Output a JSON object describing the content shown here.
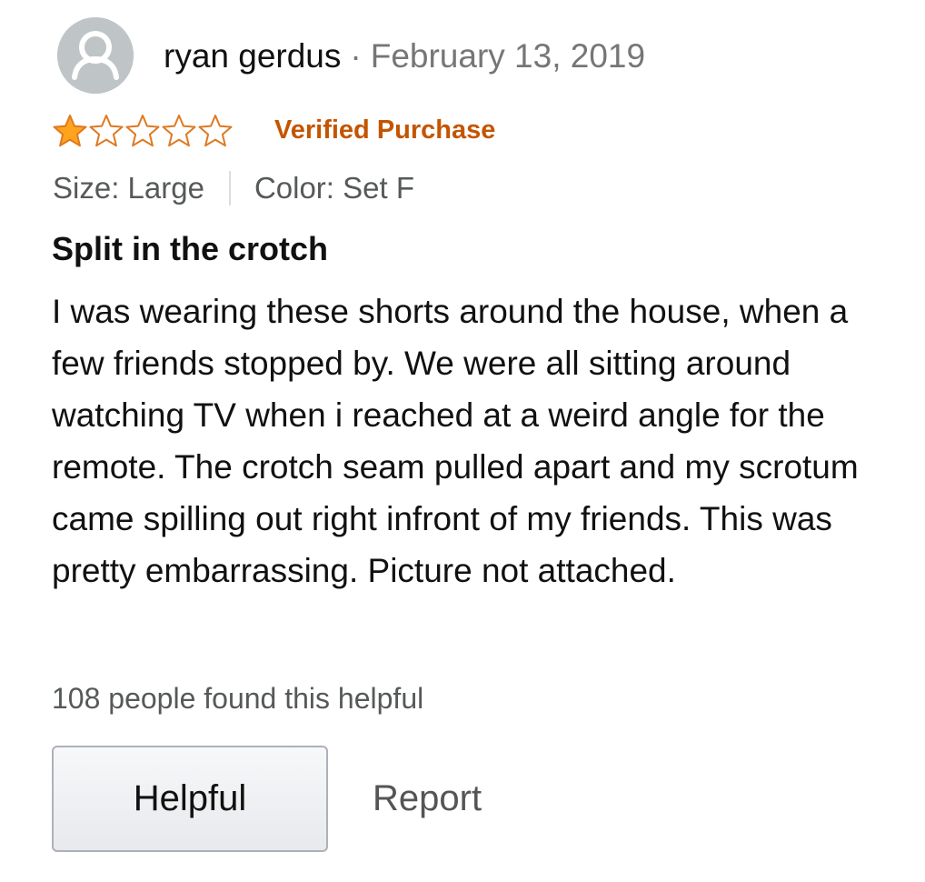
{
  "review": {
    "author": "ryan gerdus",
    "separator": "·",
    "date": "February 13, 2019",
    "rating": 1,
    "rating_max": 5,
    "verified_label": "Verified Purchase",
    "size": "Size: Large",
    "color": "Color: Set F",
    "title": "Split in the crotch",
    "body": "I was wearing these shorts around the house, when a few friends stopped by. We were all sitting around watching TV when i reached at a weird angle for the remote. The crotch seam pulled apart and my scrotum came spilling out right infront of my friends. This was pretty embarrassing. Picture not attached.",
    "helpful_count_text": "108 people found this helpful"
  },
  "actions": {
    "helpful_label": "Helpful",
    "report_label": "Report"
  },
  "icons": {
    "avatar": "user-avatar-icon",
    "star_filled": "star-filled-icon",
    "star_empty": "star-empty-icon"
  },
  "colors": {
    "star": "#ffa41c",
    "star_outline": "#de7921",
    "verified": "#c45500",
    "avatar_bg": "#bfc5c6",
    "muted_text": "#767676"
  }
}
